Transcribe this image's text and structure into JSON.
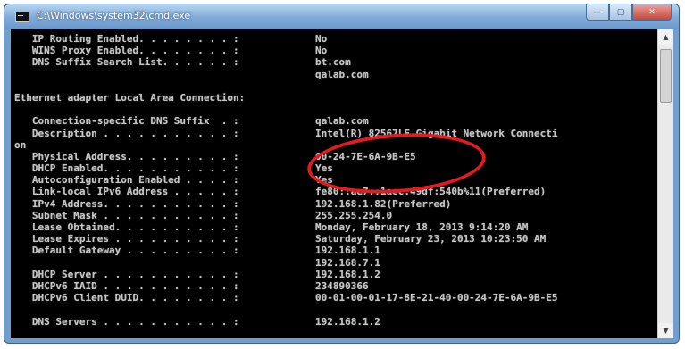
{
  "window": {
    "title": "C:\\Windows\\system32\\cmd.exe",
    "controls": {
      "minimize": "—",
      "maximize": "▢",
      "close": "✕"
    }
  },
  "console": {
    "lines": [
      {
        "label": "   IP Routing Enabled. . . . . . . . : ",
        "value": "No"
      },
      {
        "label": "   WINS Proxy Enabled. . . . . . . . : ",
        "value": "No"
      },
      {
        "label": "   DNS Suffix Search List. . . . . . : ",
        "value": "bt.com"
      },
      {
        "label": "",
        "value": "qalab.com"
      },
      {
        "label": "",
        "value": ""
      },
      {
        "label": "Ethernet adapter Local Area Connection:",
        "value": ""
      },
      {
        "label": "",
        "value": ""
      },
      {
        "label": "   Connection-specific DNS Suffix  . : ",
        "value": "qalab.com"
      },
      {
        "label": "   Description . . . . . . . . . . . : ",
        "value": "Intel(R) 82567LF Gigabit Network Connecti"
      },
      {
        "label": "on",
        "value": ""
      },
      {
        "label": "   Physical Address. . . . . . . . . : ",
        "value": "00-24-7E-6A-9B-E5"
      },
      {
        "label": "   DHCP Enabled. . . . . . . . . . . : ",
        "value": "Yes"
      },
      {
        "label": "   Autoconfiguration Enabled . . . . : ",
        "value": "Yes"
      },
      {
        "label": "   Link-local IPv6 Address . . . . . : ",
        "value": "fe80::ae7::1aec:49df:540b%11(Preferred)"
      },
      {
        "label": "   IPv4 Address. . . . . . . . . . . : ",
        "value": "192.168.1.82(Preferred)"
      },
      {
        "label": "   Subnet Mask . . . . . . . . . . . : ",
        "value": "255.255.254.0"
      },
      {
        "label": "   Lease Obtained. . . . . . . . . . : ",
        "value": "Monday, February 18, 2013 9:14:20 AM"
      },
      {
        "label": "   Lease Expires . . . . . . . . . . : ",
        "value": "Saturday, February 23, 2013 10:23:50 AM"
      },
      {
        "label": "   Default Gateway . . . . . . . . . : ",
        "value": "192.168.1.1"
      },
      {
        "label": "",
        "value": "192.168.7.1"
      },
      {
        "label": "   DHCP Server . . . . . . . . . . . : ",
        "value": "192.168.1.2"
      },
      {
        "label": "   DHCPv6 IAID . . . . . . . . . . . : ",
        "value": "234890366"
      },
      {
        "label": "   DHCPv6 Client DUID. . . . . . . . : ",
        "value": "00-01-00-01-17-8E-21-40-00-24-7E-6A-9B-E5"
      },
      {
        "label": "",
        "value": ""
      },
      {
        "label": "   DNS Servers . . . . . . . . . . . : ",
        "value": "192.168.1.2"
      }
    ]
  },
  "annotation": {
    "color": "#e11b22",
    "shape": "ellipse",
    "highlights": "Physical Address"
  },
  "colors": {
    "console_background": "#000000",
    "console_text": "#c4c4c4",
    "titlebar": "#7fa9d6"
  }
}
